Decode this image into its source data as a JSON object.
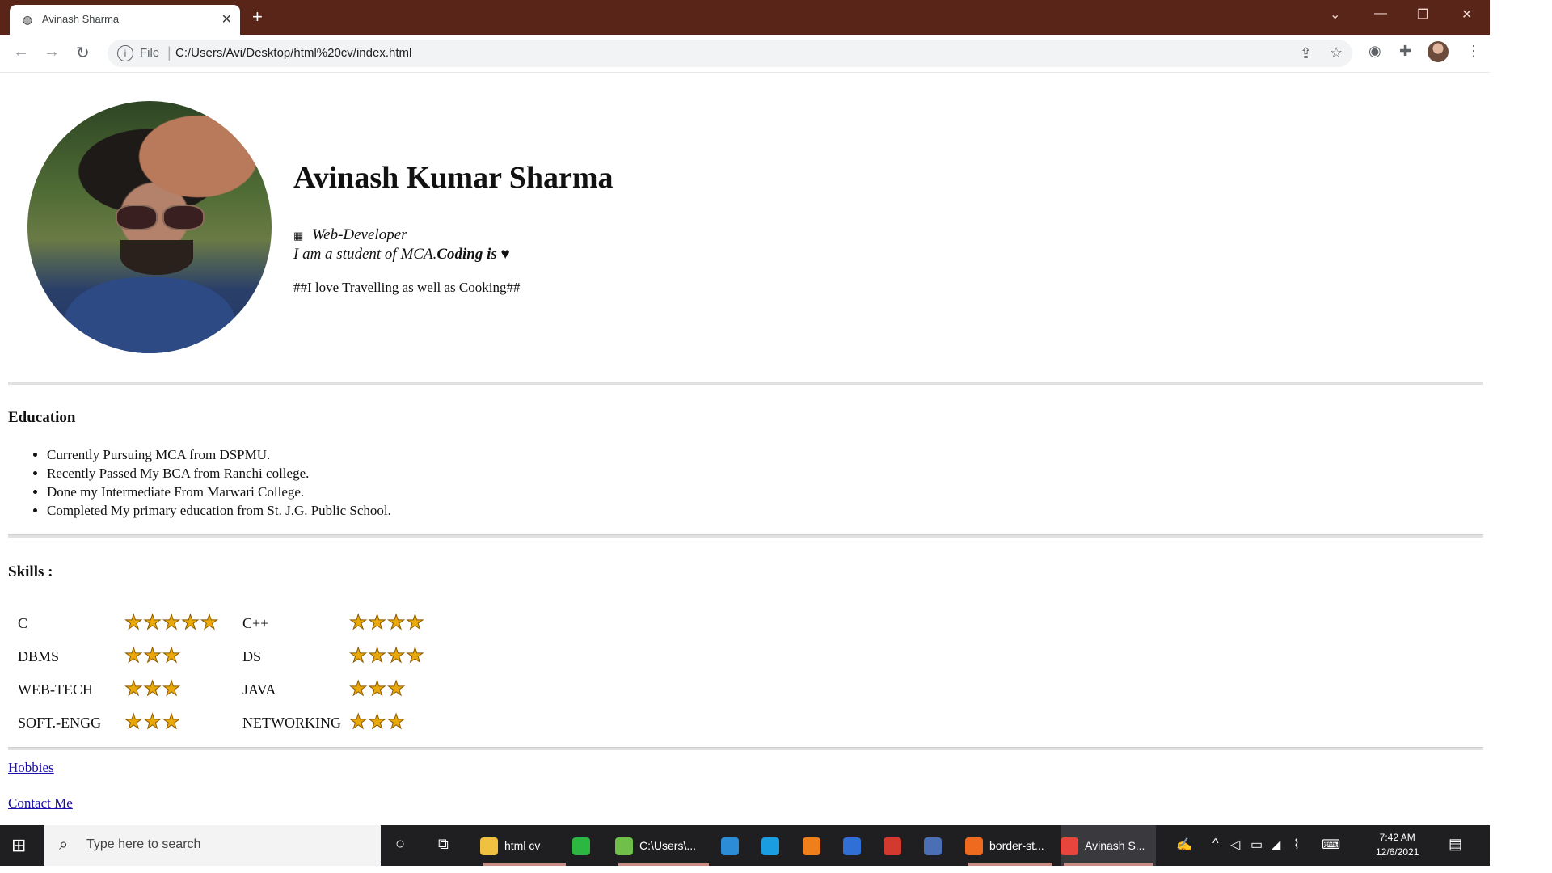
{
  "browser": {
    "tab_title": "Avinash Sharma",
    "tab_close": "✕",
    "new_tab": "+",
    "window_controls": [
      "⌄",
      "—",
      "❐",
      "✕"
    ],
    "nav": [
      "←",
      "→",
      "↻"
    ],
    "url_scheme_label": "File",
    "url": "C:/Users/Avi/Desktop/html%20cv/index.html",
    "toolbar_icons": [
      "share-icon",
      "star-icon",
      "extension-icon",
      "puzzle-icon",
      "profile-avatar",
      "menu-icon"
    ]
  },
  "profile": {
    "name": "Avinash Kumar Sharma",
    "role_icon": "▦",
    "role": "Web-Developer",
    "study_prefix": "I am a student of MCA.",
    "study_bold": "Coding is",
    "study_heart": "♥",
    "hobby_line": "##I love Travelling as well as Cooking##"
  },
  "education": {
    "title": "Education",
    "items": [
      "Currently Pursuing MCA from DSPMU.",
      "Recently Passed My BCA from Ranchi college.",
      "Done my Intermediate From Marwari College.",
      "Completed My primary education from St. J.G. Public School."
    ]
  },
  "skills": {
    "title": "Skills :",
    "rows": [
      [
        {
          "name": "C",
          "stars": 5
        },
        {
          "name": "C++",
          "stars": 4
        }
      ],
      [
        {
          "name": "DBMS",
          "stars": 3
        },
        {
          "name": "DS",
          "stars": 4
        }
      ],
      [
        {
          "name": "WEB-TECH",
          "stars": 3
        },
        {
          "name": "JAVA",
          "stars": 3
        }
      ],
      [
        {
          "name": "SOFT.-ENGG",
          "stars": 3
        },
        {
          "name": "NETWORKING",
          "stars": 3
        }
      ]
    ]
  },
  "links": {
    "hobbies": "Hobbies",
    "contact": "Contact Me"
  },
  "taskbar": {
    "search_placeholder": "Type here to search",
    "apps": [
      {
        "label": "html cv",
        "icon": "folder-icon",
        "color": "#f0c040"
      },
      {
        "label": "",
        "icon": "whatsapp-icon",
        "color": "#2bb741"
      },
      {
        "label": "C:\\Users\\...",
        "icon": "notepad-icon",
        "color": "#6fbf4a"
      },
      {
        "label": "",
        "icon": "vscode-icon",
        "color": "#2c8dd6"
      },
      {
        "label": "",
        "icon": "edge-icon",
        "color": "#1b9de2"
      },
      {
        "label": "",
        "icon": "sublime-icon",
        "color": "#ef7f1a"
      },
      {
        "label": "",
        "icon": "store-icon",
        "color": "#2f6fd6"
      },
      {
        "label": "",
        "icon": "app-icon",
        "color": "#d23a2e"
      },
      {
        "label": "",
        "icon": "monitor-icon",
        "color": "#4a6fb5"
      },
      {
        "label": "border-st...",
        "icon": "firefox-icon",
        "color": "#ef6a1f"
      },
      {
        "label": "Avinash S...",
        "icon": "chrome-icon",
        "color": "#e8453c"
      }
    ],
    "time": "7:42 AM",
    "date": "12/6/2021"
  }
}
